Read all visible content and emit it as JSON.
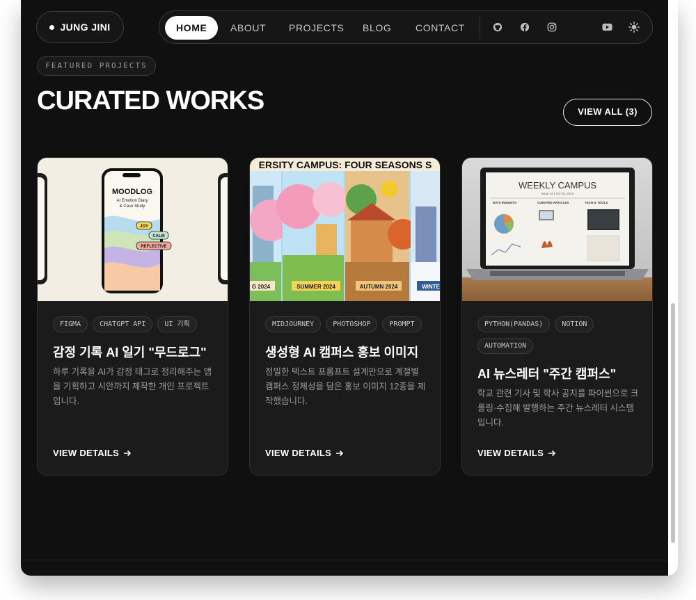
{
  "brand": {
    "name": "JUNG JINI"
  },
  "nav": {
    "links": [
      {
        "label": "HOME",
        "active": true
      },
      {
        "label": "ABOUT",
        "active": false
      },
      {
        "label": "PROJECTS",
        "active": false
      },
      {
        "label": "BLOG",
        "active": false
      },
      {
        "label": "CONTACT",
        "active": false
      }
    ],
    "icons": [
      "github-icon",
      "facebook-icon",
      "instagram-icon",
      "youtube-icon",
      "theme-toggle-icon"
    ]
  },
  "section": {
    "eyebrow": "FEATURED PROJECTS",
    "title": "CURATED WORKS",
    "view_all": "VIEW ALL (3)"
  },
  "cards": [
    {
      "image_text": {
        "title": "MOODLOG",
        "subtitle1": "AI Emotion Diary",
        "subtitle2": "& Case Study",
        "tag1": "JOY",
        "tag2": "CALM",
        "tag3": "REFLECTIVE"
      },
      "tags": [
        "FIGMA",
        "CHATGPT API",
        "UI 기획"
      ],
      "title": "감정 기록 AI 일기 \"무드로그\"",
      "desc": "하루 기록을 AI가 감정 태그로 정리해주는 앱을 기획하고 시안까지 제작한 개인 프로젝트입니다.",
      "link": "VIEW DETAILS"
    },
    {
      "image_text": {
        "banner": "ERSITY CAMPUS: FOUR SEASONS S",
        "l1": "G 2024",
        "l2": "SUMMER 2024",
        "l3": "AUTUMN 2024",
        "l4": "WINTE"
      },
      "tags": [
        "MIDJOURNEY",
        "PHOTOSHOP",
        "PROMPT"
      ],
      "title": "생성형 AI 캠퍼스 홍보 이미지",
      "desc": "정밀한 텍스트 프롬프트 설계만으로 계절별 캠퍼스 정체성을 담은 홍보 이미지 12종을 제작했습니다.",
      "link": "VIEW DETAILS"
    },
    {
      "image_text": {
        "title": "WEEKLY CAMPUS",
        "issue": "Issue 42 | Oct 26, 2024",
        "col1": "DATA INSIGHTS",
        "col2": "CURATED ARTICLES",
        "col3": "TECH & TOOLS"
      },
      "tags": [
        "PYTHON(PANDAS)",
        "NOTION",
        "AUTOMATION"
      ],
      "title": "AI 뉴스레터 \"주간 캠퍼스\"",
      "desc": "학교 관련 기사 및 학사 공지를 파이썬으로 크롤링·수집해 발행하는 주간 뉴스레터 시스템입니다.",
      "link": "VIEW DETAILS"
    }
  ],
  "colors": {
    "background": "#101010",
    "card": "#1b1b1b",
    "accent": "#ffffff"
  }
}
